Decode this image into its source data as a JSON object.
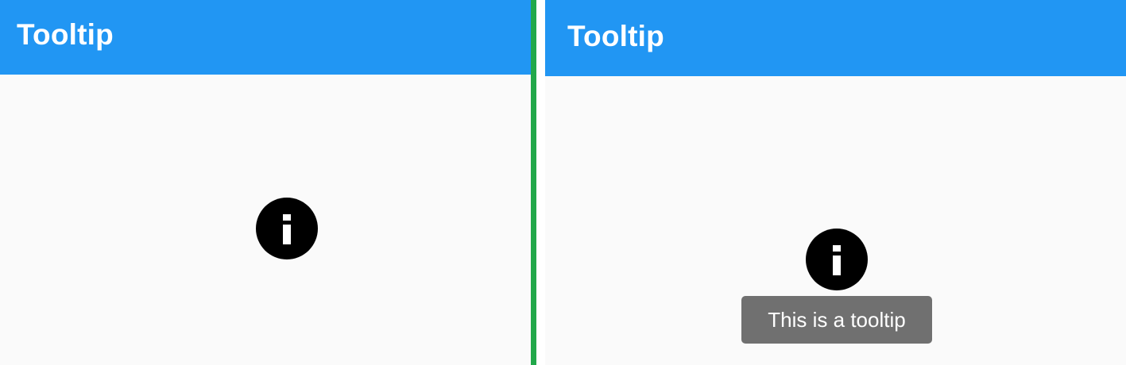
{
  "colors": {
    "appbar": "#2196f3",
    "background": "#fafafa",
    "divider": "#22a84a",
    "tooltip_bg": "#707070",
    "icon": "#000000"
  },
  "left_screen": {
    "appbar_title": "Tooltip",
    "icon": "info-icon"
  },
  "right_screen": {
    "appbar_title": "Tooltip",
    "icon": "info-icon",
    "tooltip_text": "This is a tooltip"
  }
}
